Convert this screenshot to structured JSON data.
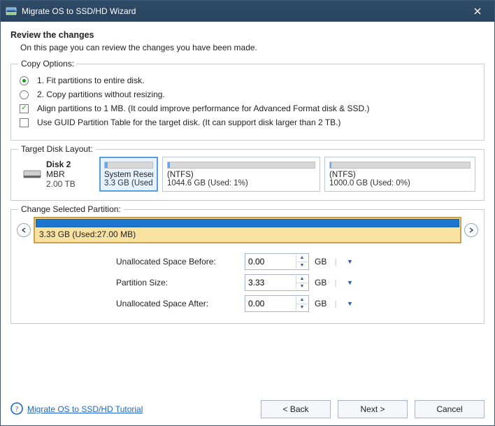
{
  "title": "Migrate OS to SSD/HD Wizard",
  "header": {
    "title": "Review the changes",
    "subtitle": "On this page you can review the changes you have been made."
  },
  "copy_options": {
    "legend": "Copy Options:",
    "radio1": "1. Fit partitions to entire disk.",
    "radio2": "2. Copy partitions without resizing.",
    "check1": "Align partitions to 1 MB.  (It could improve performance for Advanced Format disk & SSD.)",
    "check2": "Use GUID Partition Table for the target disk. (It can support disk larger than 2 TB.)"
  },
  "target_disk": {
    "legend": "Target Disk Layout:",
    "disk": {
      "name": "Disk 2",
      "type": "MBR",
      "size": "2.00 TB"
    },
    "p1": {
      "name": "System Reser",
      "detail": "3.3 GB (Used:"
    },
    "p2": {
      "name": "(NTFS)",
      "detail": "1044.6 GB (Used: 1%)"
    },
    "p3": {
      "name": "(NTFS)",
      "detail": "1000.0 GB (Used: 0%)"
    }
  },
  "change_partition": {
    "legend": "Change Selected Partition:",
    "label": "3.33 GB (Used:27.00 MB)"
  },
  "form": {
    "before_label": "Unallocated Space Before:",
    "before_value": "0.00",
    "size_label": "Partition Size:",
    "size_value": "3.33",
    "after_label": "Unallocated Space After:",
    "after_value": "0.00",
    "unit": "GB"
  },
  "footer": {
    "tutorial": "Migrate OS to SSD/HD Tutorial",
    "back": "< Back",
    "next": "Next >",
    "cancel": "Cancel"
  }
}
